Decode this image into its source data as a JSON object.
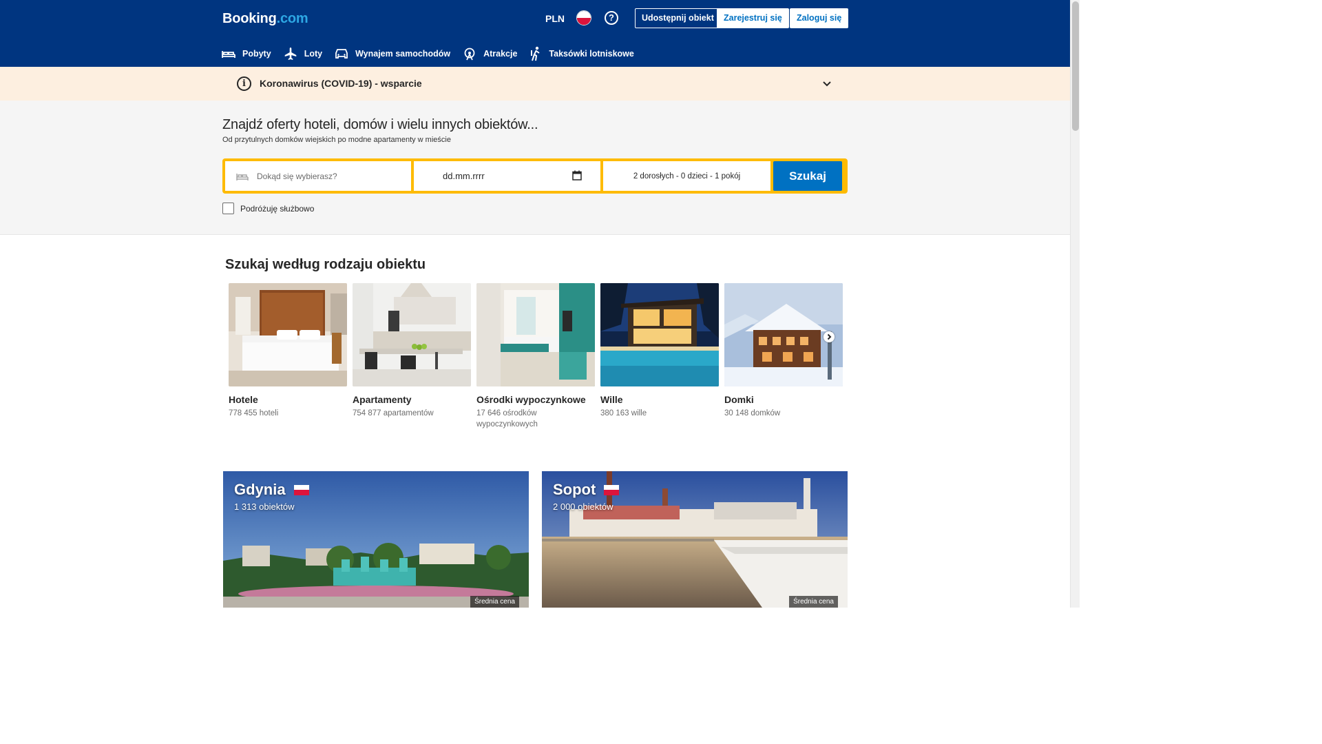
{
  "header": {
    "logo_main": "Booking",
    "logo_dot": ".com",
    "currency": "PLN",
    "help": "?",
    "list_property": "Udostępnij obiekt",
    "register": "Zarejestruj się",
    "login": "Zaloguj się"
  },
  "nav": [
    {
      "label": "Pobyty",
      "icon": "bed-icon"
    },
    {
      "label": "Loty",
      "icon": "plane-icon"
    },
    {
      "label": "Wynajem samochodów",
      "icon": "car-icon"
    },
    {
      "label": "Atrakcje",
      "icon": "attractions-icon"
    },
    {
      "label": "Taksówki lotniskowe",
      "icon": "taxi-icon"
    }
  ],
  "covid": {
    "text": "Koronawirus (COVID-19) - wsparcie"
  },
  "hero": {
    "title": "Znajdź oferty hoteli, domów i wielu innych obiektów...",
    "subtitle": "Od przytulnych domków wiejskich po modne apartamenty w mieście"
  },
  "search": {
    "destination_placeholder": "Dokąd się wybierasz?",
    "date_value": "dd.mm.rrrr",
    "guests": "2 dorosłych - 0 dzieci - 1 pokój",
    "button": "Szukaj",
    "business_label": "Podróżuję służbowo"
  },
  "property_types": {
    "title": "Szukaj według rodzaju obiektu",
    "items": [
      {
        "name": "Hotele",
        "count": "778 455 hoteli"
      },
      {
        "name": "Apartamenty",
        "count": "754 877 apartamentów"
      },
      {
        "name": "Ośrodki wypoczynkowe",
        "count": "17 646 ośrodków wypoczynkowych"
      },
      {
        "name": "Wille",
        "count": "380 163 wille"
      },
      {
        "name": "Domki",
        "count": "30 148 domków"
      }
    ]
  },
  "cities": [
    {
      "name": "Gdynia",
      "count": "1 313 obiektów",
      "price_label": "Średnia cena"
    },
    {
      "name": "Sopot",
      "count": "2 000 obiektów",
      "price_label": "Średnia cena"
    }
  ],
  "colors": {
    "brand_blue": "#003580",
    "action_blue": "#0071c2",
    "search_yellow": "#febb02",
    "covid_bg": "#fdefe0"
  }
}
